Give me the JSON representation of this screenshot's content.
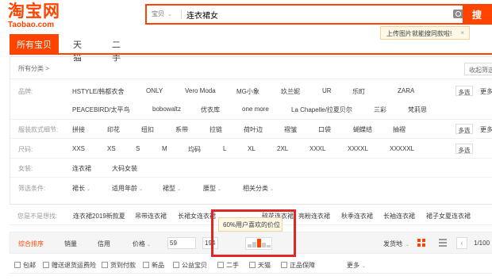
{
  "header": {
    "logo_cn": "淘宝网",
    "logo_en": "Taobao.com",
    "search": {
      "type_label": "宝贝",
      "query": "连衣裙女",
      "button_label": "搜",
      "image_search_tip": "上传图片就能搜同款啦!"
    }
  },
  "tabs": [
    "所有宝贝",
    "天猫",
    "二手"
  ],
  "filters": {
    "all_categories": "所有分类 >",
    "collapse_label": "收起筛选",
    "multi_label": "多选",
    "more_label": "更多",
    "brand": {
      "label": "品牌:",
      "row1": [
        "HSTYLE/韩都衣舍",
        "ONLY",
        "Vero Moda",
        "MG小象",
        "玖兰妮",
        "UR",
        "乐町",
        "ZARA"
      ],
      "row2": [
        "PEACEBIRD/太平鸟",
        "bobowaltz",
        "优衣库",
        "one more",
        "La Chapelle/拉夏贝尔",
        "三彩",
        "梵莉思"
      ]
    },
    "style_detail": {
      "label": "服装款式细节:",
      "values": [
        "拼接",
        "印花",
        "纽扣",
        "系带",
        "拉链",
        "荷叶边",
        "褶皱",
        "口袋",
        "蝴蝶结",
        "抽褶"
      ]
    },
    "size": {
      "label": "尺码:",
      "values": [
        "XXS",
        "XS",
        "S",
        "M",
        "均码",
        "L",
        "XL",
        "2XL",
        "XXXL",
        "XXXXL",
        "XXXXXL"
      ]
    },
    "women": {
      "label": "女装:",
      "values": [
        "连衣裙",
        "大码女装"
      ]
    },
    "conditions": {
      "label": "筛选条件:",
      "values": [
        "裙长",
        "适用年龄",
        "裙型",
        "腰型",
        "相关分类"
      ]
    }
  },
  "suggestions": {
    "label": "您是不是想找:",
    "items": [
      "连衣裙2019新款夏",
      "吊带连衣裙",
      "长裙女连衣裙",
      "碎花连衣裙",
      "亮粉连衣裙",
      "秋季连衣裙",
      "长袖连衣裙",
      "裙子女夏连衣裙"
    ]
  },
  "sortbar": {
    "sorts": [
      "综合排序",
      "销量",
      "信用",
      "价格"
    ],
    "price_min": "59",
    "price_max": "194",
    "price_tip": "60%用户喜欢的价位",
    "ship_from": "发货地",
    "pager": "1/100"
  },
  "checkboxes": [
    "包邮",
    "赠送退货运费险",
    "货到付款",
    "新品",
    "公益宝贝",
    "二手",
    "天猫",
    "正品保障"
  ],
  "checkbox_more": "更多",
  "colors": {
    "accent": "#ff4400",
    "highlight": "#e0262a"
  }
}
